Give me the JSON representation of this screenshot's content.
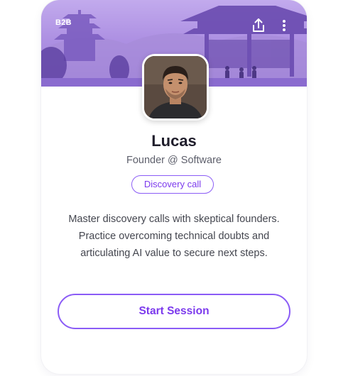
{
  "card": {
    "tag": "B2B",
    "name": "Lucas",
    "role": "Founder @ Software",
    "badge": "Discovery call",
    "description": "Master discovery calls with skeptical founders. Practice overcoming technical doubts and articulating AI value to secure next steps.",
    "start_button": "Start Session"
  },
  "icons": {
    "share": "share-icon",
    "more": "more-vertical-icon"
  },
  "colors": {
    "accent": "#7c3aed",
    "accent_border": "#8b5cf6",
    "banner": "#a98ce0",
    "name_text": "#1f1d2b",
    "body_text": "#44464f"
  }
}
